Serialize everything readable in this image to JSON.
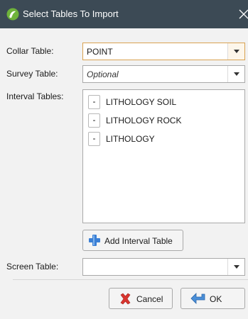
{
  "window": {
    "title": "Select Tables To Import",
    "close_glyph": "✕"
  },
  "icons": {
    "app": "leapfrog-app-icon",
    "close": "close-icon",
    "dropdown": "chevron-down-icon",
    "add": "plus-icon",
    "cancel": "cancel-x-icon",
    "ok": "ok-arrow-icon"
  },
  "colors": {
    "titlebar": "#3c4a55",
    "focus_border": "#d9a251",
    "add_icon": "#3a7fd5",
    "cancel_icon": "#d9352f",
    "ok_icon": "#4a8fd8"
  },
  "collar": {
    "label": "Collar Table:",
    "value": "POINT"
  },
  "survey": {
    "label": "Survey Table:",
    "placeholder": "Optional"
  },
  "interval": {
    "label": "Interval Tables:",
    "items": [
      {
        "remove": "-",
        "name": "LITHOLOGY SOIL"
      },
      {
        "remove": "-",
        "name": "LITHOLOGY ROCK"
      },
      {
        "remove": "-",
        "name": "LITHOLOGY"
      }
    ],
    "add_button": "Add Interval Table"
  },
  "screen": {
    "label": "Screen Table:",
    "value": ""
  },
  "buttons": {
    "cancel": "Cancel",
    "ok": "OK"
  }
}
